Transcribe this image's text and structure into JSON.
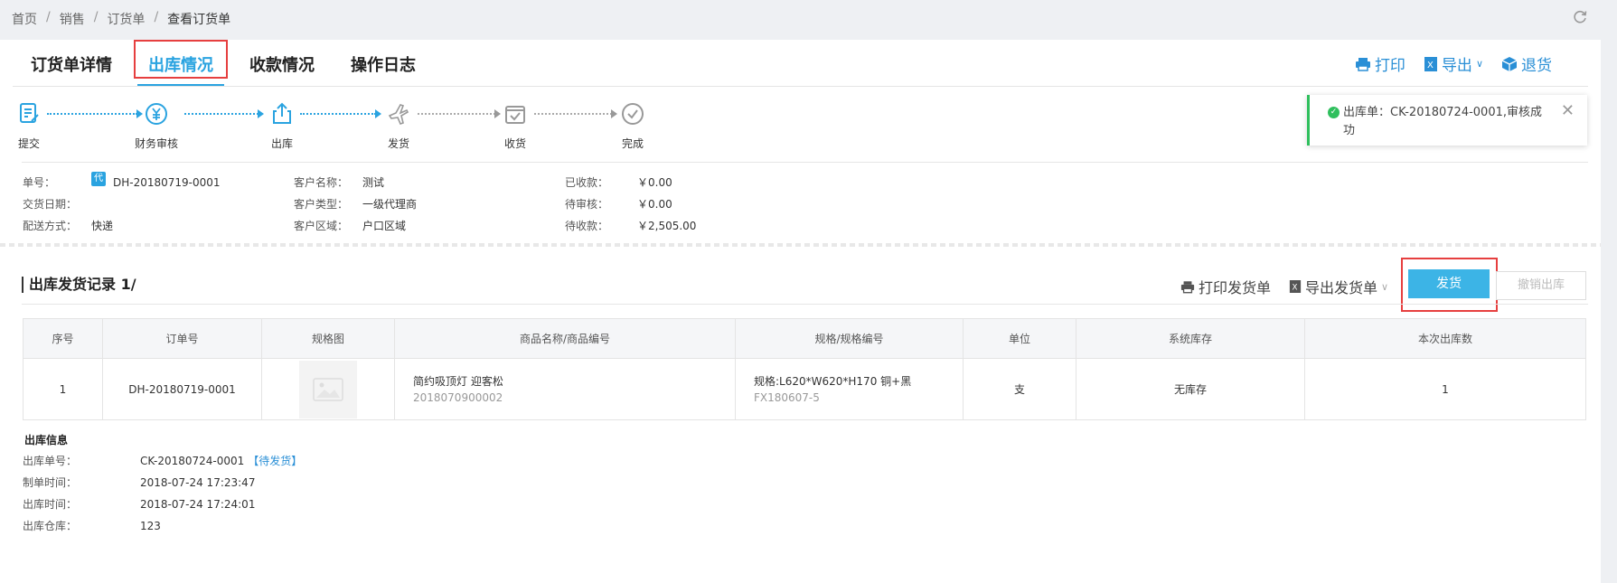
{
  "breadcrumb": {
    "items": [
      "首页",
      "销售",
      "订货单",
      "查看订货单"
    ],
    "sep": "/"
  },
  "tabs": [
    {
      "label": "订货单详情",
      "active": false
    },
    {
      "label": "出库情况",
      "active": true
    },
    {
      "label": "收款情况",
      "active": false
    },
    {
      "label": "操作日志",
      "active": false
    }
  ],
  "actions": {
    "print": "打印",
    "export": "导出",
    "return": "退货"
  },
  "steps": [
    "提交",
    "财务审核",
    "出库",
    "发货",
    "收货",
    "完成"
  ],
  "toast": {
    "text": "出库单：CK-20180724-0001,审核成",
    "text2": "功"
  },
  "info": {
    "col1": [
      {
        "k": "单号：",
        "tag": "代",
        "v": "DH-20180719-0001"
      },
      {
        "k": "交货日期：",
        "v": ""
      },
      {
        "k": "配送方式：",
        "v": "快递"
      }
    ],
    "col2": [
      {
        "k": "客户名称：",
        "v": "测试"
      },
      {
        "k": "客户类型：",
        "v": "一级代理商"
      },
      {
        "k": "客户区域：",
        "v": "户口区域"
      }
    ],
    "col3": [
      {
        "k": "已收款：",
        "v": "￥0.00"
      },
      {
        "k": "待审核：",
        "v": "￥0.00"
      },
      {
        "k": "待收款：",
        "v": "￥2,505.00"
      }
    ]
  },
  "section": {
    "title": "出库发货记录 1/",
    "print_delivery": "打印发货单",
    "export_delivery": "导出发货单",
    "ship_btn": "发货",
    "cancel_btn": "撤销出库"
  },
  "table": {
    "headers": [
      "序号",
      "订单号",
      "规格图",
      "商品名称/商品编号",
      "规格/规格编号",
      "单位",
      "系统库存",
      "本次出库数"
    ],
    "rows": [
      {
        "no": "1",
        "order": "DH-20180719-0001",
        "name": "简约吸顶灯 迎客松",
        "code": "2018070900002",
        "spec": "规格:L620*W620*H170 铜+黑",
        "spec_code": "FX180607-5",
        "unit": "支",
        "stock": "无库存",
        "qty": "1"
      }
    ]
  },
  "outbound": {
    "title": "出库信息",
    "rows": [
      {
        "k": "出库单号：",
        "v": "CK-20180724-0001",
        "status": "【待发货】"
      },
      {
        "k": "制单时间：",
        "v": "2018-07-24 17:23:47"
      },
      {
        "k": "出库时间：",
        "v": "2018-07-24 17:24:01"
      },
      {
        "k": "出库仓库：",
        "v": "123"
      }
    ]
  },
  "colors": {
    "accent": "#2aa3e0",
    "highlight": "#e63f3f",
    "success": "#2fbf5d",
    "button": "#3cb4e6"
  }
}
